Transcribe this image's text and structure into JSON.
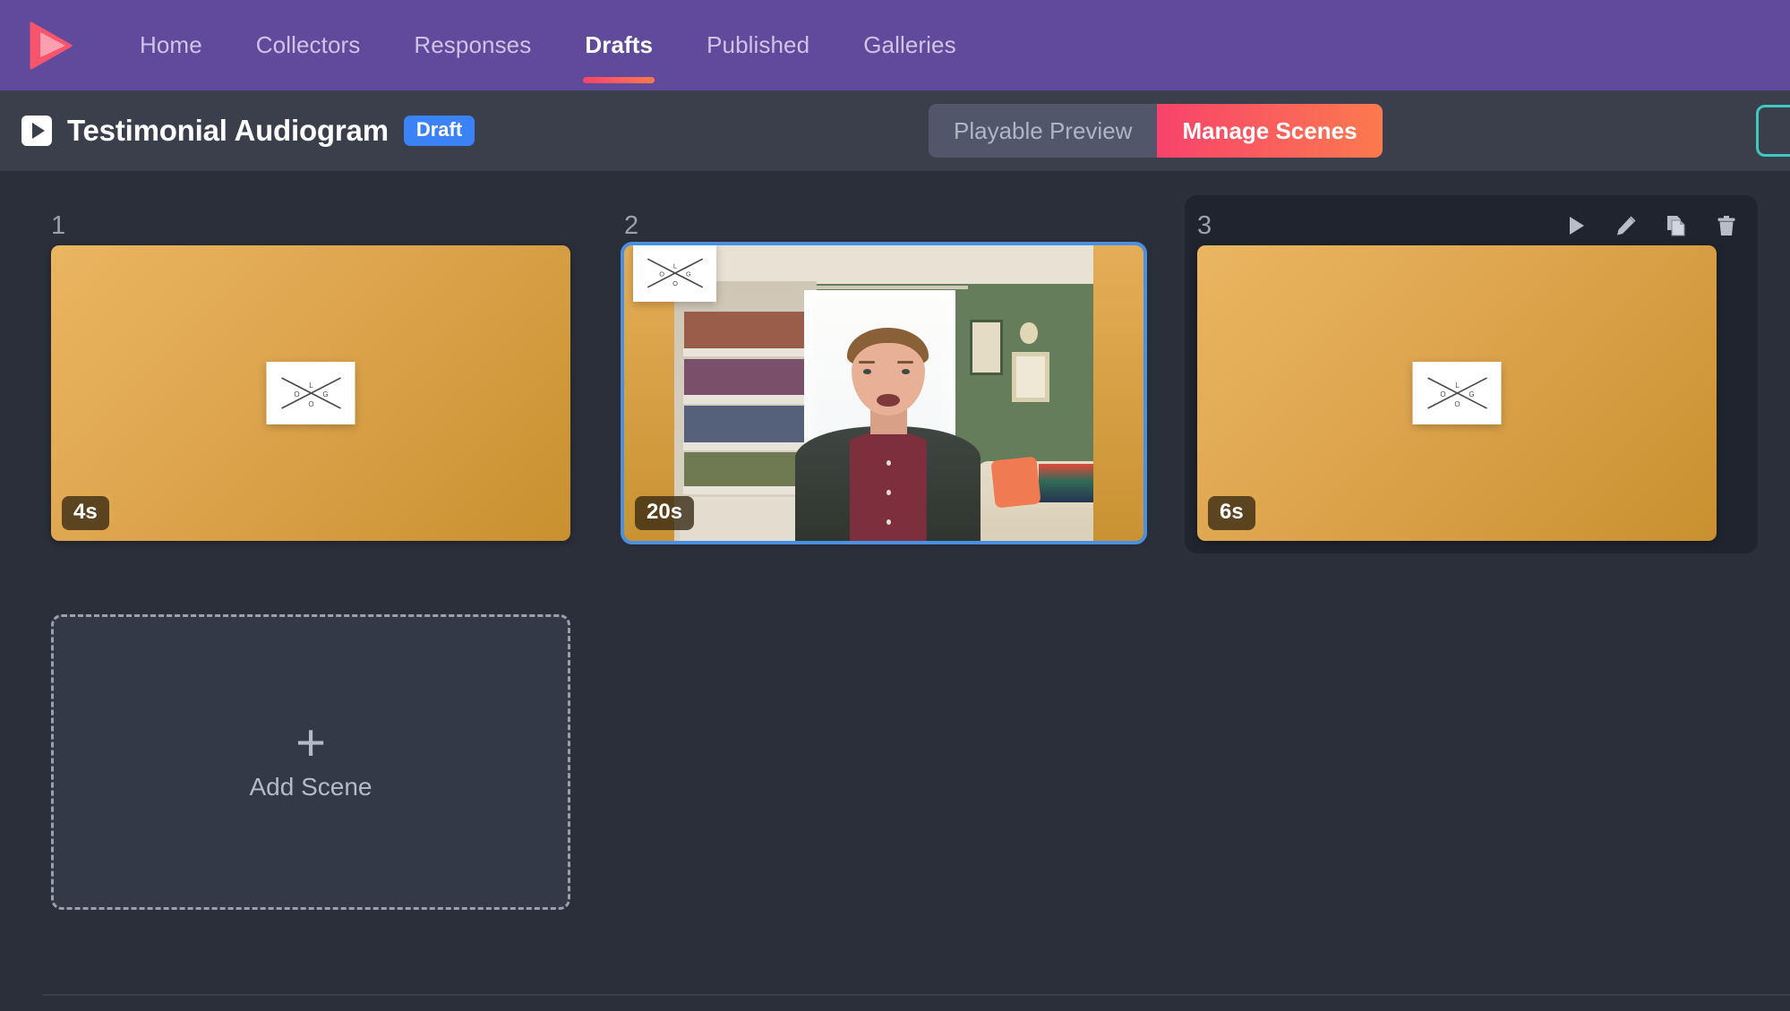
{
  "nav": {
    "logo_icon": "play-triangle-logo",
    "items": [
      {
        "label": "Home",
        "active": false
      },
      {
        "label": "Collectors",
        "active": false
      },
      {
        "label": "Responses",
        "active": false
      },
      {
        "label": "Drafts",
        "active": true
      },
      {
        "label": "Published",
        "active": false
      },
      {
        "label": "Galleries",
        "active": false
      }
    ],
    "background_color": "#5f4a9c",
    "active_underline_gradient": [
      "#f8436b",
      "#fb7a4e"
    ]
  },
  "titlebar": {
    "play_icon": "play-icon",
    "title": "Testimonial Audiogram",
    "status_badge": "Draft",
    "status_badge_color": "#3b82f6",
    "segmented": {
      "preview_label": "Playable Preview",
      "manage_label": "Manage Scenes",
      "active": "Manage Scenes",
      "active_gradient": [
        "#f8436b",
        "#fb7a4e"
      ]
    }
  },
  "board": {
    "scenes": [
      {
        "number": "1",
        "duration": "4s",
        "kind": "logo",
        "selected": false,
        "hovered": false,
        "logo_letters": {
          "top": "L",
          "left": "O",
          "right": "G",
          "bottom": "O"
        }
      },
      {
        "number": "2",
        "duration": "20s",
        "kind": "video",
        "selected": true,
        "hovered": false,
        "logo_letters": {
          "top": "L",
          "left": "O",
          "right": "G",
          "bottom": "O"
        }
      },
      {
        "number": "3",
        "duration": "6s",
        "kind": "logo",
        "selected": false,
        "hovered": true,
        "logo_letters": {
          "top": "L",
          "left": "O",
          "right": "G",
          "bottom": "O"
        },
        "tools": [
          {
            "name": "play-icon",
            "label": "Play"
          },
          {
            "name": "pencil-icon",
            "label": "Edit"
          },
          {
            "name": "duplicate-icon",
            "label": "Duplicate"
          },
          {
            "name": "trash-icon",
            "label": "Delete"
          }
        ]
      }
    ],
    "add_scene": {
      "plus_glyph": "+",
      "label": "Add Scene"
    },
    "selection_color": "#4a90e2",
    "thumb_gradient": [
      "#eab561",
      "#c9902f"
    ]
  }
}
